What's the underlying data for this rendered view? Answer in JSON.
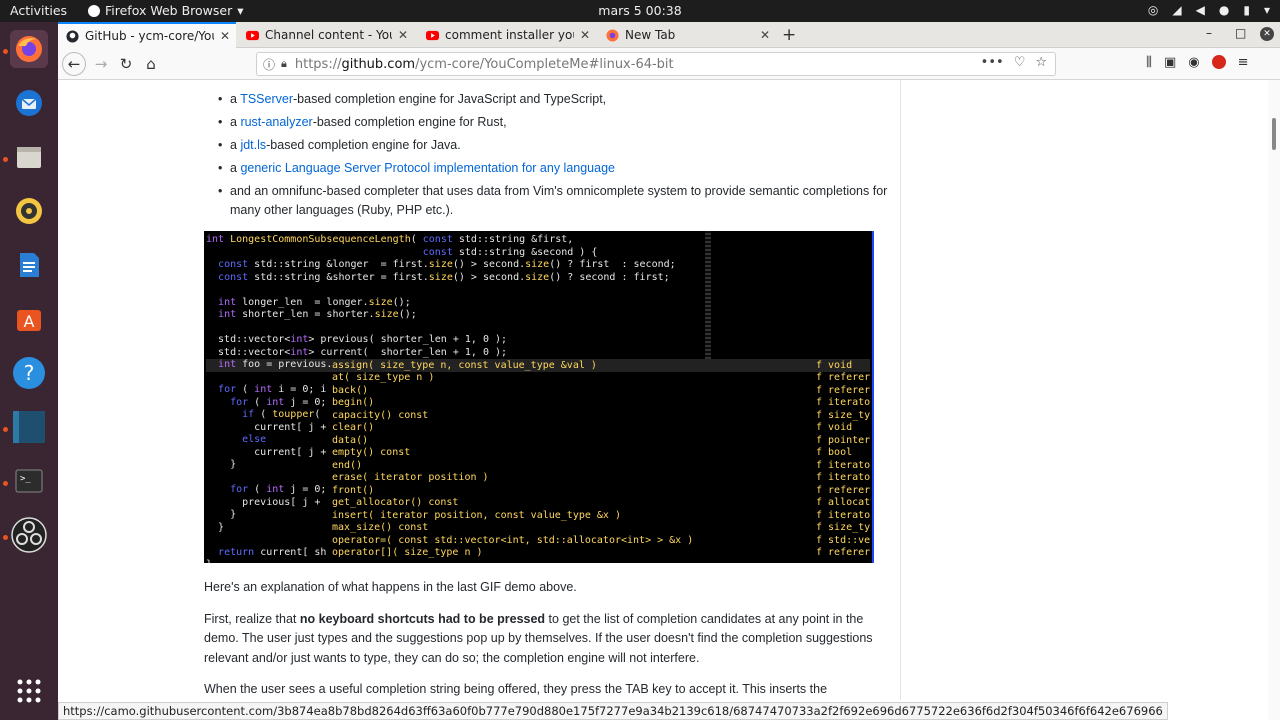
{
  "topbar": {
    "activities": "Activities",
    "app_name": "Firefox Web Browser",
    "app_menu_arrow": "▾",
    "clock": "mars 5  00:38",
    "tray_icons": [
      "accessibility-icon",
      "wifi-icon",
      "volume-icon",
      "microphone-icon",
      "battery-icon",
      "power-menu-icon"
    ]
  },
  "dock": {
    "items": [
      "firefox",
      "thunderbird",
      "files",
      "rhythmbox",
      "libreoffice-writer",
      "software-center",
      "help",
      "app-blue",
      "terminal",
      "obs-studio"
    ],
    "show_apps": "show-applications-icon"
  },
  "tabs": [
    {
      "title": "GitHub - ycm-core/YouCo",
      "favicon": "github-icon",
      "active": true
    },
    {
      "title": "Channel content - YouTu",
      "favicon": "youtube-icon",
      "active": false
    },
    {
      "title": "comment installer youco",
      "favicon": "youtube-icon",
      "active": false
    },
    {
      "title": "New Tab",
      "favicon": "firefox-icon",
      "active": false
    }
  ],
  "tab_close": "✕",
  "new_tab": "+",
  "window": {
    "minimize": "–",
    "maximize": "□",
    "close": "✕"
  },
  "nav": {
    "back": "←",
    "forward": "→",
    "reload": "↻",
    "home": "⌂"
  },
  "url": {
    "scheme": "https://",
    "host": "github.com",
    "path": "/ycm-core/YouCompleteMe#linux-64-bit",
    "more": "•••",
    "pocket": "♡",
    "bookmark": "☆"
  },
  "toolbar_icons": [
    "library-icon",
    "sidebar-icon",
    "profile-icon",
    "adblock-icon",
    "menu-icon"
  ],
  "article": {
    "bullets": [
      {
        "pre": "a ",
        "link": "TSServer",
        "post": "-based completion engine for JavaScript and TypeScript,"
      },
      {
        "pre": "a ",
        "link": "rust-analyzer",
        "post": "-based completion engine for Rust,"
      },
      {
        "pre": "a ",
        "link": "jdt.ls",
        "post": "-based completion engine for Java."
      },
      {
        "pre": "a ",
        "link": "generic Language Server Protocol implementation for any language",
        "post": ""
      },
      {
        "pre": "and an omnifunc-based completer that uses data from Vim's omnicomplete system to provide semantic completions for many other languages (Ruby, PHP etc.).",
        "link": "",
        "post": ""
      }
    ],
    "demo_intro": "Here's an explanation of what happens in the last GIF demo above.",
    "para2_pre": "First, realize that ",
    "para2_bold": "no keyboard shortcuts had to be pressed",
    "para2_post": " to get the list of completion candidates at any point in the demo. The user just types and the suggestions pop up by themselves. If the user doesn't find the completion suggestions relevant and/or just wants to type, they can do so; the completion engine will not interfere.",
    "para3": "When the user sees a useful completion string being offered, they press the TAB key to accept it. This inserts the"
  },
  "demo": {
    "code_lines": [
      "int LongestCommonSubsequenceLength( const std::string &first,",
      "                                    const std::string &second ) {",
      "  const std::string &longer  = first.size() > second.size() ? first  : second;",
      "  const std::string &shorter = first.size() > second.size() ? second : first;",
      "",
      "  int longer_len  = longer.size();",
      "  int shorter_len = shorter.size();",
      "",
      "  std::vector<int> previous( shorter_len + 1, 0 );",
      "  std::vector<int> current(  shorter_len + 1, 0 );",
      "  int foo = previous."
    ],
    "left_lines": [
      "",
      "  for ( int i = 0; i",
      "    for ( int j = 0;",
      "      if ( toupper(",
      "        current[ j +",
      "      else",
      "        current[ j +",
      "    }",
      "",
      "    for ( int j = 0;",
      "      previous[ j +",
      "    }",
      "  }",
      "",
      "  return current[ sh",
      "}"
    ],
    "popup": [
      "assign( size_type n, const value_type &val )",
      "at( size_type n )",
      "back()",
      "begin()",
      "capacity() const",
      "clear()",
      "data()",
      "empty() const",
      "end()",
      "erase( iterator position )",
      "front()",
      "get_allocator() const",
      "insert( iterator position, const value_type &x )",
      "max_size() const",
      "operator=( const std::vector<int, std::allocator<int> > &x )",
      "operator[]( size_type n )"
    ],
    "kinds": [
      "f void",
      "f referer",
      "f referer",
      "f iterato",
      "f size_ty",
      "f void",
      "f pointer",
      "f bool",
      "f iterato",
      "f iterato",
      "f referer",
      "f allocat",
      "f iterato",
      "f size_ty",
      "f std::ve",
      "f referer"
    ]
  },
  "status_url": "https://camo.githubusercontent.com/3b874ea8b78bd8264d63ff63a60f0b777e790d880e175f7277e9a34b2139c618/68747470733a2f2f692e696d6775722e636f6d2f304f50346f6f642e676966"
}
